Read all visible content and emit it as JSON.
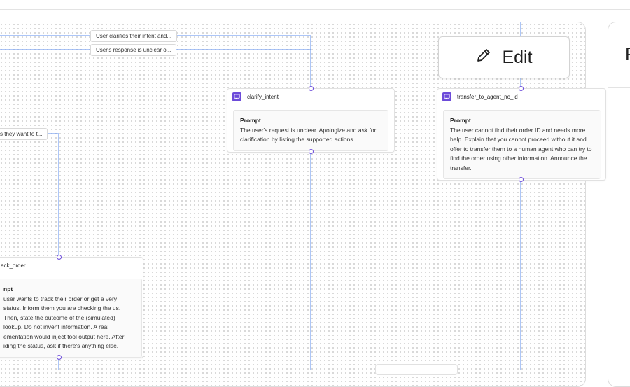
{
  "edges": {
    "label_1": "User clarifies their intent and...",
    "label_2": "User's response is unclear o...",
    "label_3": "s they want to t..."
  },
  "nodes": {
    "clarify_intent": {
      "title": "clarify_intent",
      "prompt_label": "Prompt",
      "prompt_text": "The user's request is unclear. Apologize and ask for clarification by listing the supported actions."
    },
    "transfer": {
      "title": "transfer_to_agent_no_id",
      "prompt_label": "Prompt",
      "prompt_text": "The user cannot find their order ID and needs more help. Explain that you cannot proceed without it and offer to transfer them to a human agent who can try to find the order using other information. Announce the transfer."
    },
    "track_order": {
      "title": "ack_order",
      "prompt_label": "npt",
      "prompt_text": "user wants to track their order or get a very status. Inform them you are checking the us. Then, state the outcome of the (simulated) lookup. Do not invent information. A real ementation would inject tool output here. After iding the status, ask if there's anything else."
    }
  },
  "toolbar": {
    "edit_label": "Edit"
  },
  "side_panel": {
    "header_initial": "P"
  },
  "colors": {
    "edge": "#5b8def",
    "accent": "#6c4bd9"
  }
}
